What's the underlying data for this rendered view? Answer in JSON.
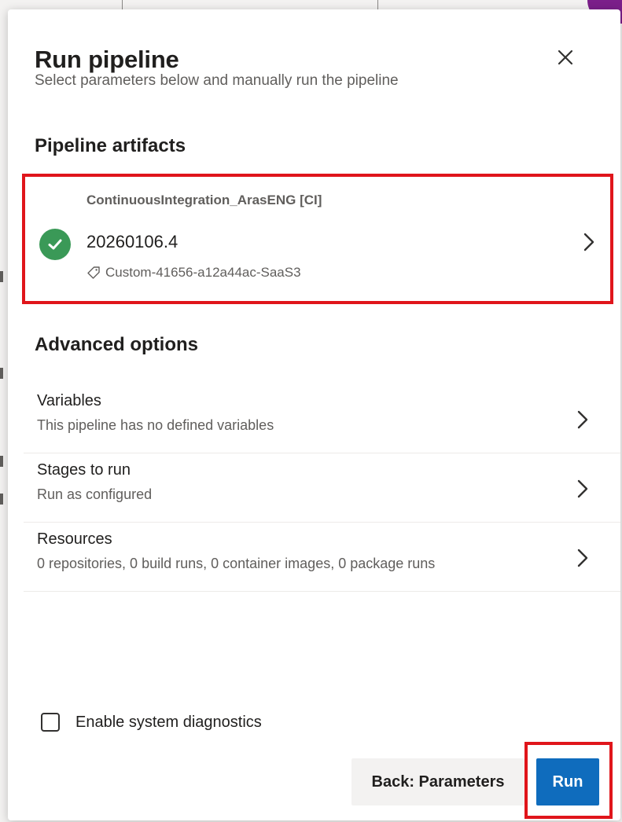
{
  "dialog": {
    "title": "Run pipeline",
    "subtitle": "Select parameters below and manually run the pipeline"
  },
  "artifacts": {
    "heading": "Pipeline artifacts",
    "pipeline_name": "ContinuousIntegration_ArasENG [CI]",
    "version": "20260106.4",
    "tag": "Custom-41656-a12a44ac-SaaS3",
    "status_color": "#3a9957"
  },
  "advanced": {
    "heading": "Advanced options",
    "options": [
      {
        "label": "Variables",
        "description": "This pipeline has no defined variables"
      },
      {
        "label": "Stages to run",
        "description": "Run as configured"
      },
      {
        "label": "Resources",
        "description": "0 repositories, 0 build runs, 0 container images, 0 package runs"
      }
    ]
  },
  "diagnostics": {
    "label": "Enable system diagnostics",
    "checked": false
  },
  "footer": {
    "back_label": "Back: Parameters",
    "run_label": "Run"
  },
  "colors": {
    "primary": "#0f6cbd",
    "highlight": "#e0151b"
  },
  "icons": {
    "close": "close-icon",
    "success": "check-circle-icon",
    "tag": "tag-icon",
    "chevron": "chevron-right-icon"
  }
}
